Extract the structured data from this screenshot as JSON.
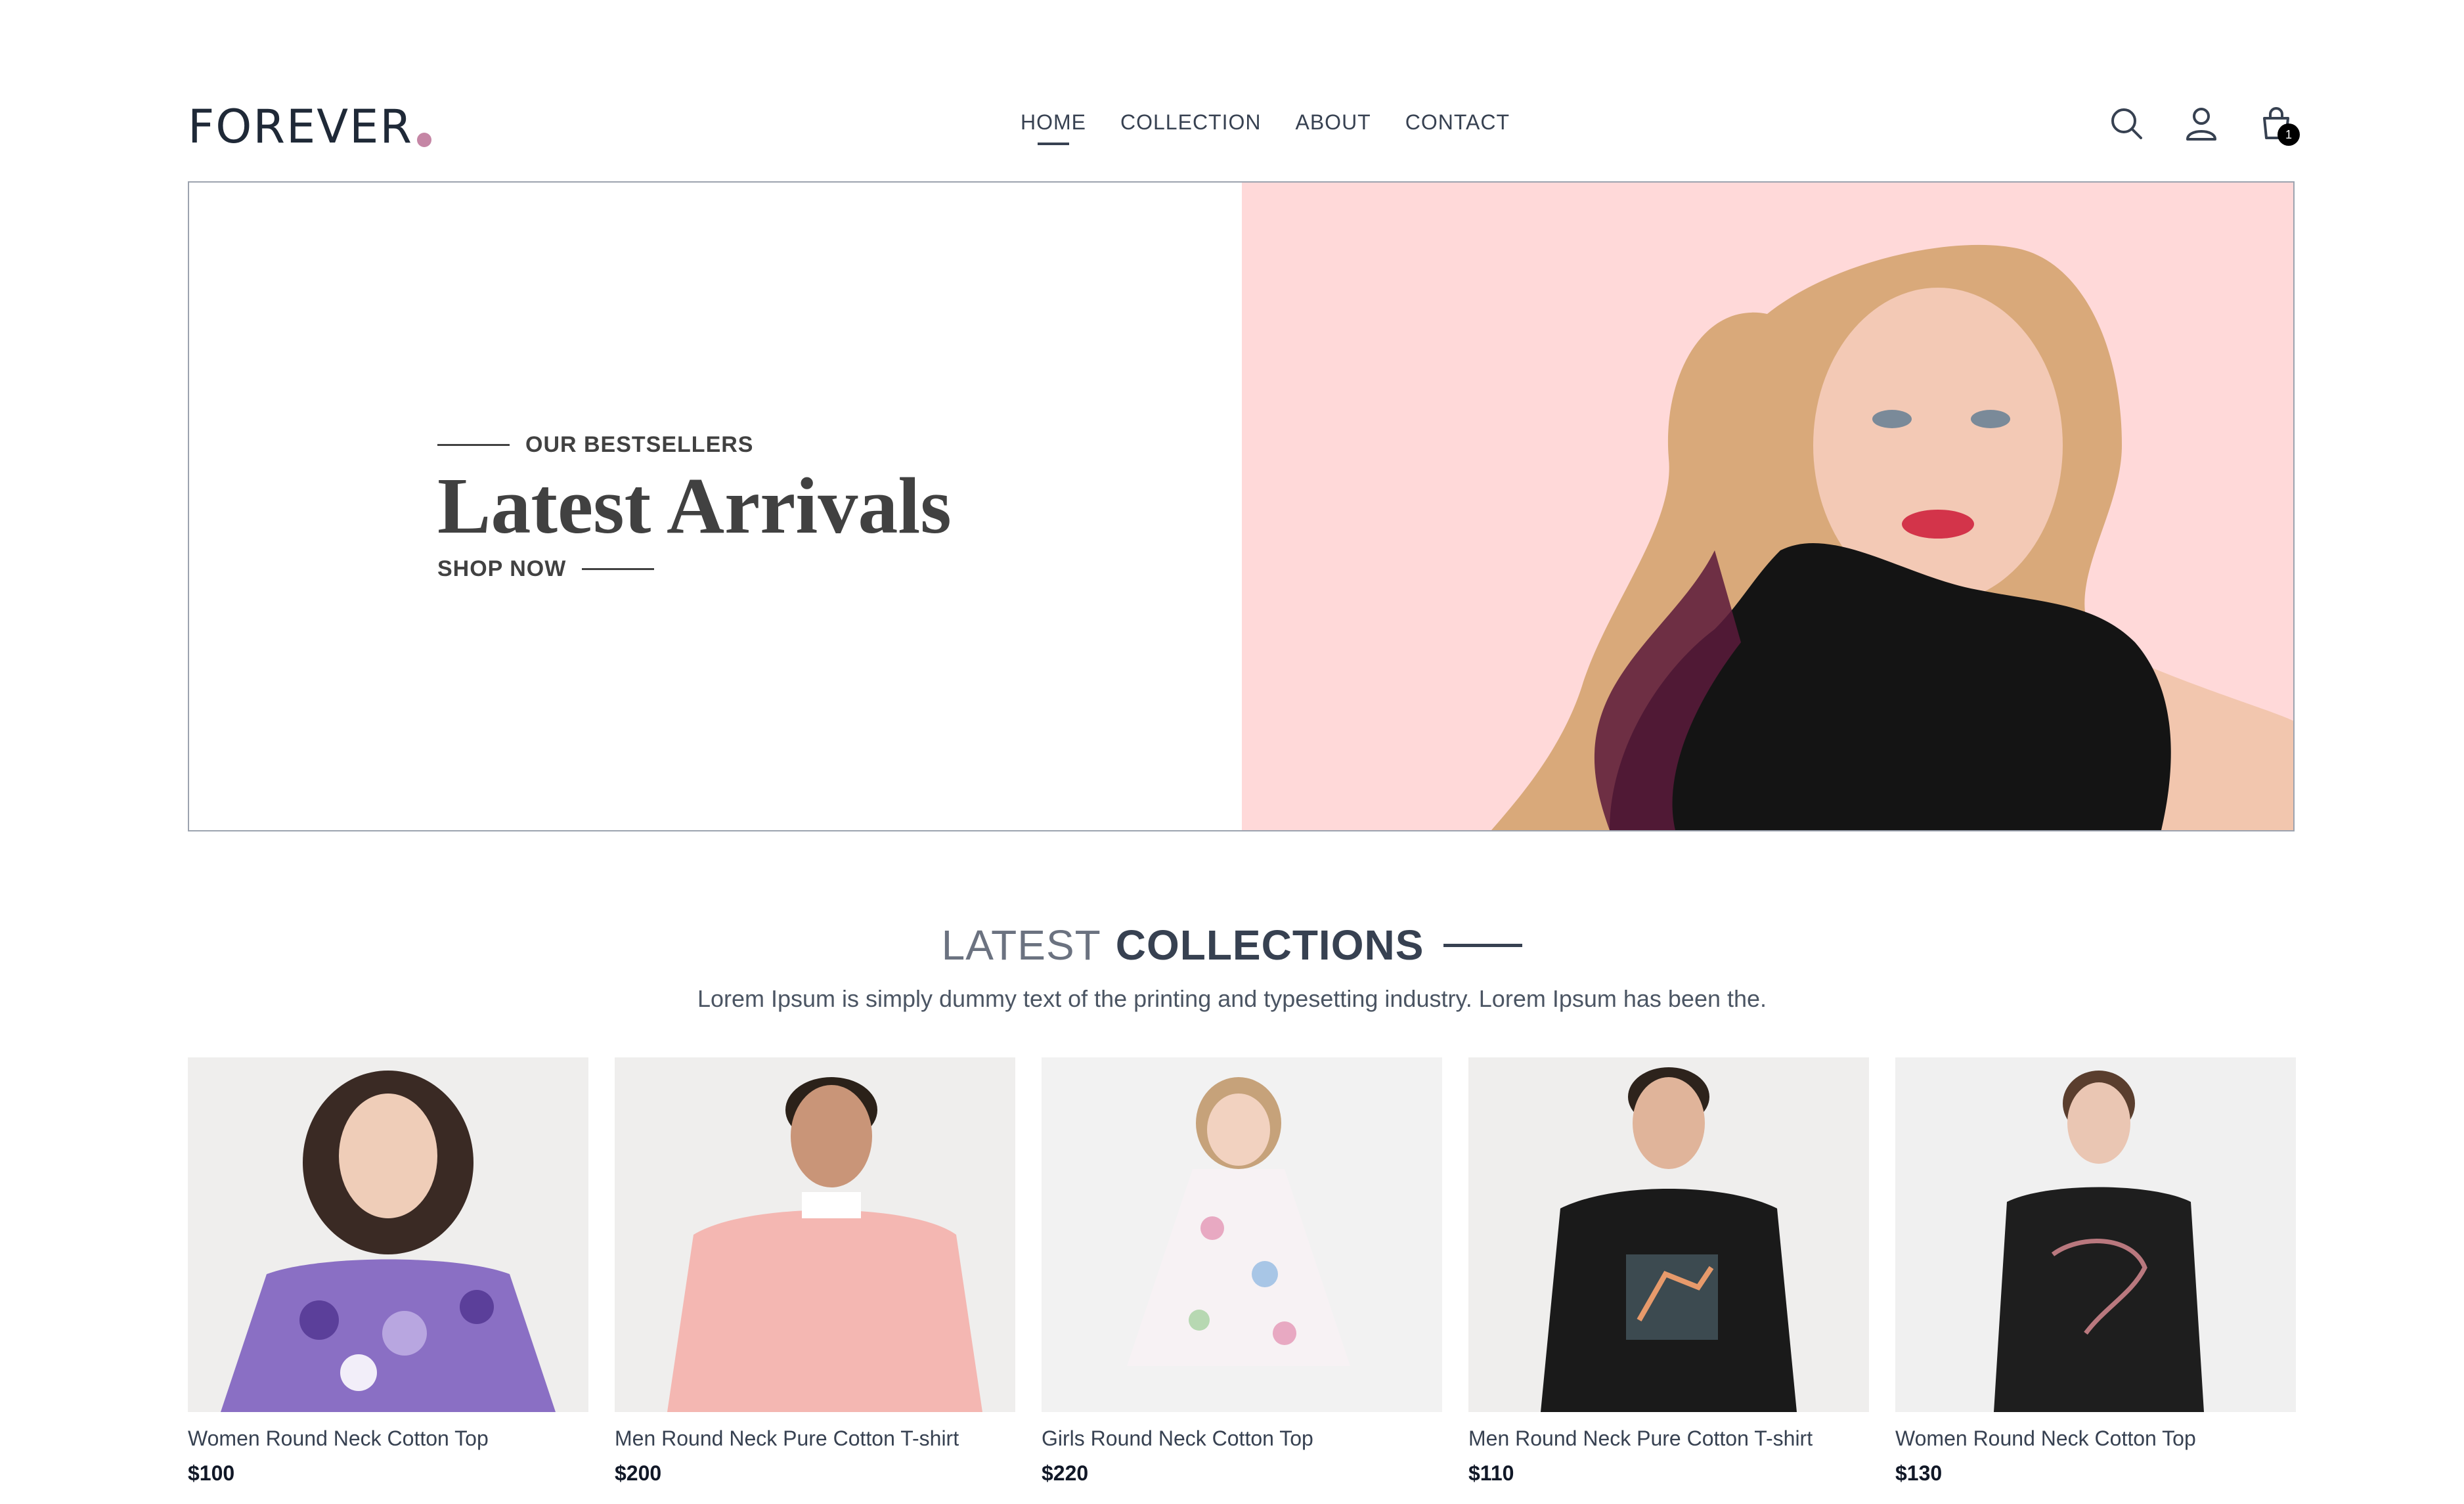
{
  "brand": {
    "name": "FOREVER",
    "dot_color": "#c586a5"
  },
  "nav": {
    "links": [
      {
        "label": "HOME",
        "active": true
      },
      {
        "label": "COLLECTION"
      },
      {
        "label": "ABOUT"
      },
      {
        "label": "CONTACT"
      }
    ],
    "icons": [
      "search-icon",
      "profile-icon",
      "cart-icon"
    ],
    "cart_count": "1"
  },
  "hero": {
    "eyebrow": "OUR BESTSELLERS",
    "title": "Latest Arrivals",
    "cta": "SHOP NOW",
    "background": "#ffd9d9"
  },
  "collections": {
    "title_light": "LATEST",
    "title_bold": "COLLECTIONS",
    "subtitle": "Lorem Ipsum is simply dummy text of the printing and typesetting industry. Lorem Ipsum has been the."
  },
  "products": [
    {
      "name": "Women Round Neck Cotton Top",
      "price": "$100"
    },
    {
      "name": "Men Round Neck Pure Cotton T-shirt",
      "price": "$200"
    },
    {
      "name": "Girls Round Neck Cotton Top",
      "price": "$220"
    },
    {
      "name": "Men Round Neck Pure Cotton T-shirt",
      "price": "$110"
    },
    {
      "name": "Women Round Neck Cotton Top",
      "price": "$130"
    }
  ]
}
